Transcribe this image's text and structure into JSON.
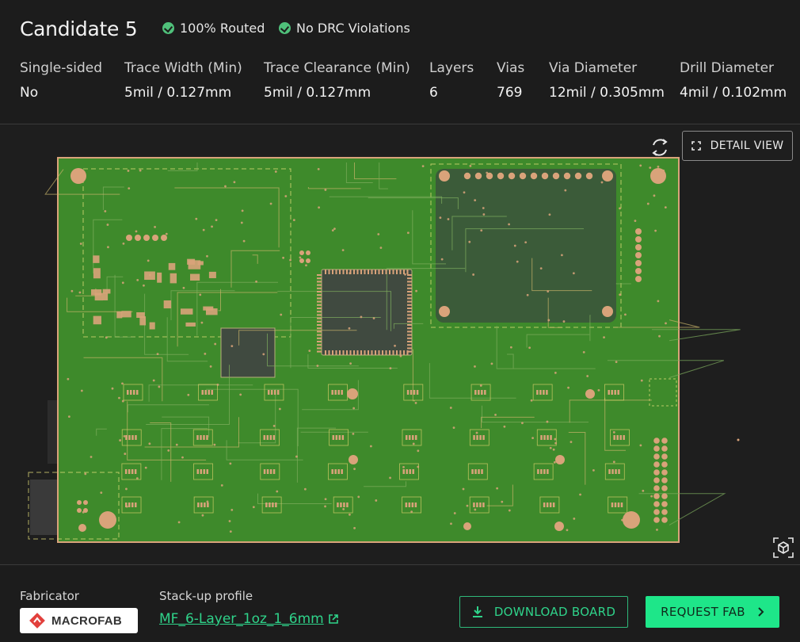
{
  "header": {
    "title": "Candidate 5",
    "badges": [
      {
        "label": "100% Routed",
        "icon": "check-circle-icon"
      },
      {
        "label": "No DRC Violations",
        "icon": "check-circle-icon"
      }
    ]
  },
  "specs": [
    {
      "label": "Single-sided",
      "value": "No"
    },
    {
      "label": "Trace Width (Min)",
      "value": "5mil / 0.127mm"
    },
    {
      "label": "Trace Clearance (Min)",
      "value": "5mil / 0.127mm"
    },
    {
      "label": "Layers",
      "value": "6"
    },
    {
      "label": "Vias",
      "value": "769"
    },
    {
      "label": "Via Diameter",
      "value": "12mil / 0.305mm"
    },
    {
      "label": "Drill Diameter",
      "value": "4mil / 0.102mm"
    }
  ],
  "viewer": {
    "detail_view_label": "DETAIL VIEW",
    "rotate_icon": "rotate-icon",
    "cube_icon": "3d-cube-icon"
  },
  "footer": {
    "fabricator_label": "Fabricator",
    "fabricator_name": "MACROFAB",
    "stackup_label": "Stack-up profile",
    "stackup_value": "MF_6-Layer_1oz_1_6mm",
    "download_label": "DOWNLOAD BOARD",
    "request_label": "REQUEST FAB"
  },
  "colors": {
    "accent": "#1ee689",
    "link": "#2fd38a",
    "board_green": "#3f8a2c",
    "copper": "#d9a37a",
    "check": "#4fc07a"
  }
}
